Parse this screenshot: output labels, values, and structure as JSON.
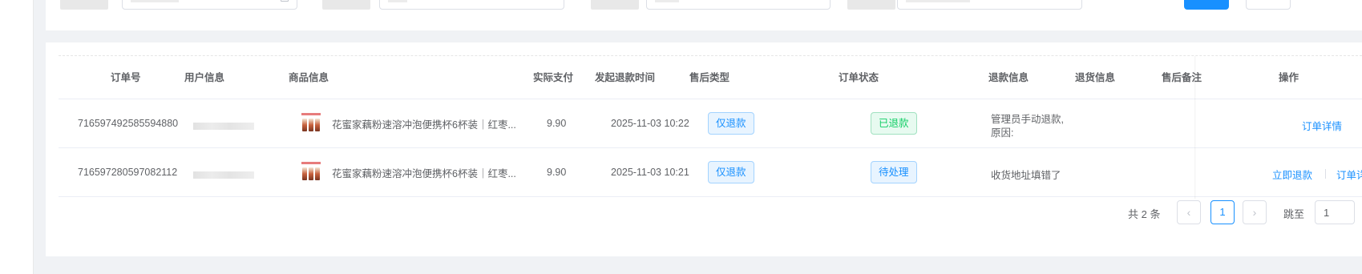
{
  "table": {
    "headers": {
      "order_no": "订单号",
      "user_info": "用户信息",
      "product_info": "商品信息",
      "paid": "实际支付",
      "refund_time": "发起退款时间",
      "aftersale_type": "售后类型",
      "order_status": "订单状态",
      "refund_info": "退款信息",
      "return_info": "退货信息",
      "aftersale_note": "售后备注",
      "actions": "操作"
    },
    "rows": [
      {
        "order_no": "716597492585594880",
        "product_name": "花蜜家藕粉速溶冲泡便携杯6杯装｜红枣...",
        "paid": "9.90",
        "refund_time": "2025-11-03 10:22",
        "aftersale_type": "仅退款",
        "order_status": "已退款",
        "refund_info_line1": "管理员手动退款,",
        "refund_info_line2": "原因:",
        "action_detail": "订单详情"
      },
      {
        "order_no": "716597280597082112",
        "product_name": "花蜜家藕粉速溶冲泡便携杯6杯装｜红枣...",
        "paid": "9.90",
        "refund_time": "2025-11-03 10:21",
        "aftersale_type": "仅退款",
        "order_status": "待处理",
        "refund_info_line1": "收货地址填错了",
        "action_refund": "立即退款",
        "action_detail": "订单详情"
      }
    ]
  },
  "pagination": {
    "total_text": "共 2 条",
    "current_page": "1",
    "prev_icon": "‹",
    "next_icon": "›",
    "jump_label": "跳至",
    "jump_value": "1"
  },
  "colors": {
    "primary": "#1890ff",
    "success": "#13ce66",
    "background": "#f0f2f5"
  }
}
